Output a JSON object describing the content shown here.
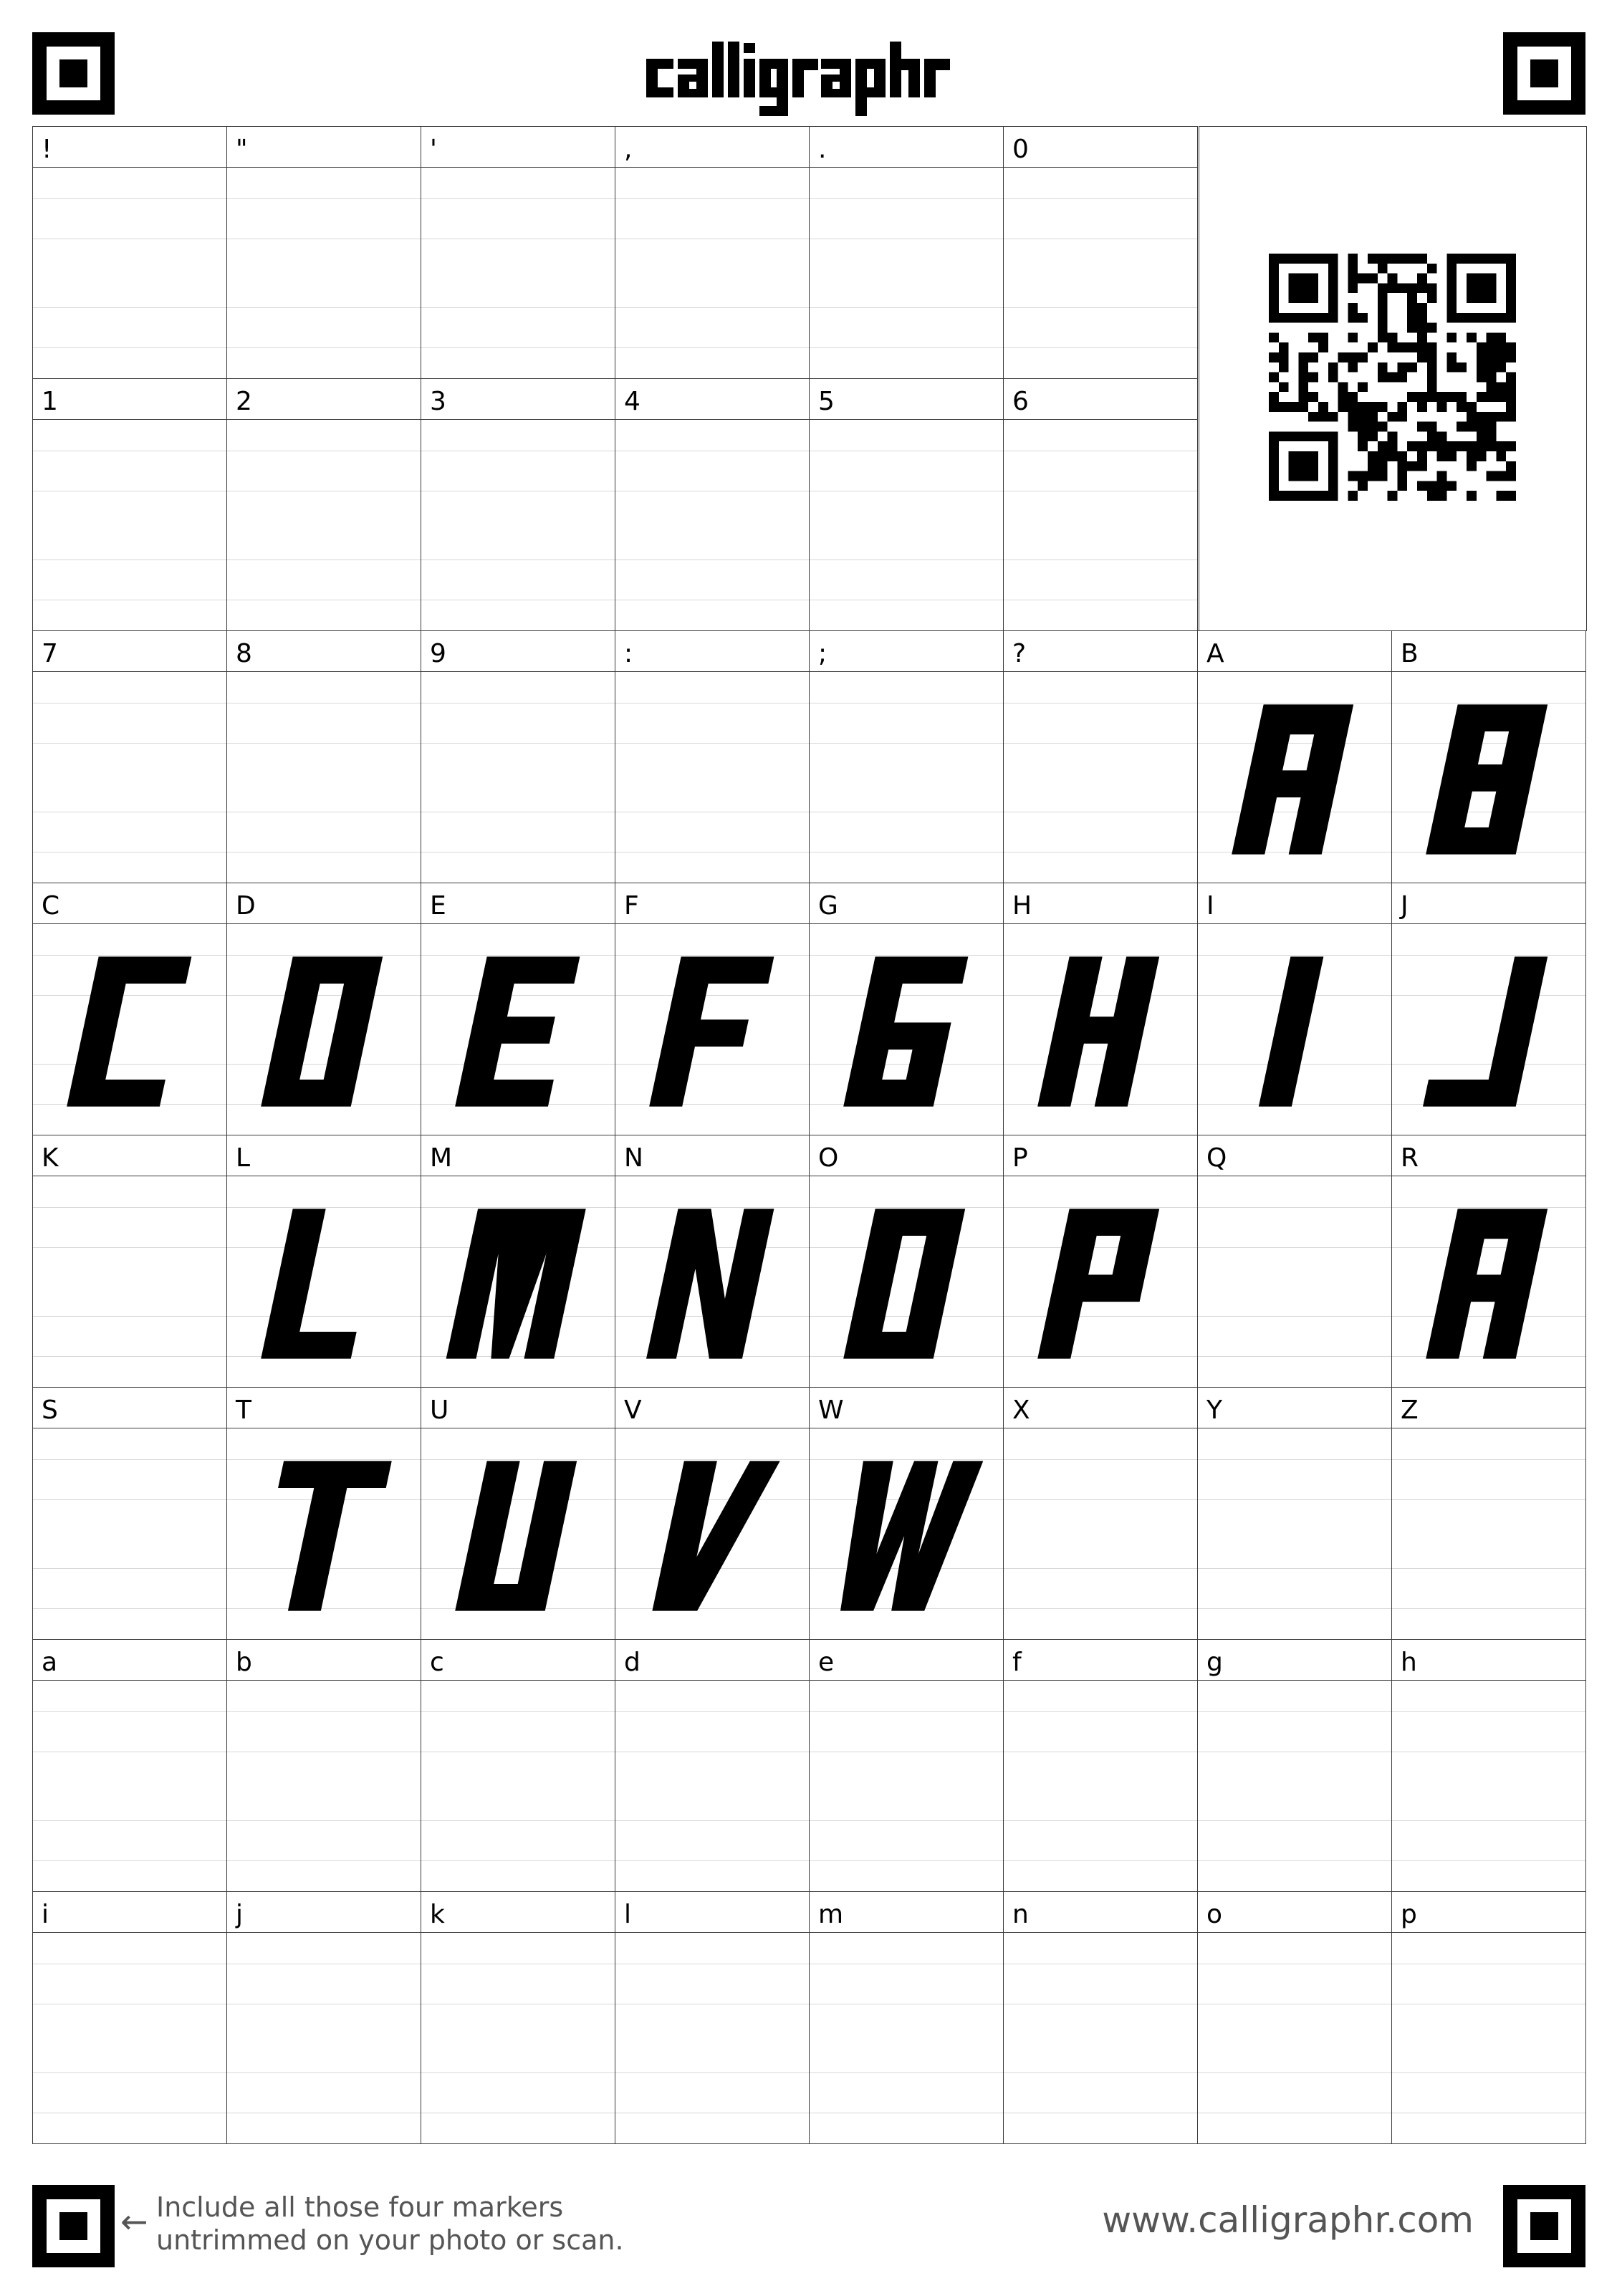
{
  "header": {
    "logo_text": "calligraphr"
  },
  "template": {
    "rows": [
      {
        "cells": [
          "!",
          "\"",
          "'",
          ",",
          ".",
          "0"
        ]
      },
      {
        "cells": [
          "1",
          "2",
          "3",
          "4",
          "5",
          "6"
        ]
      },
      {
        "cells": [
          "7",
          "8",
          "9",
          ":",
          ";",
          "?",
          "A",
          "B"
        ]
      },
      {
        "cells": [
          "C",
          "D",
          "E",
          "F",
          "G",
          "H",
          "I",
          "J"
        ]
      },
      {
        "cells": [
          "K",
          "L",
          "M",
          "N",
          "O",
          "P",
          "Q",
          "R"
        ]
      },
      {
        "cells": [
          "S",
          "T",
          "U",
          "V",
          "W",
          "X",
          "Y",
          "Z"
        ]
      },
      {
        "cells": [
          "a",
          "b",
          "c",
          "d",
          "e",
          "f",
          "g",
          "h"
        ]
      },
      {
        "cells": [
          "i",
          "j",
          "k",
          "l",
          "m",
          "n",
          "o",
          "p"
        ]
      }
    ],
    "drawn_glyphs": [
      "A",
      "B",
      "C",
      "D",
      "E",
      "F",
      "G",
      "H",
      "I",
      "J",
      "L",
      "M",
      "N",
      "O",
      "P",
      "R",
      "T",
      "U",
      "V",
      "W"
    ],
    "glyph_style": "blocky-italic-black"
  },
  "qr": {
    "icon": "qr-code-icon"
  },
  "footer": {
    "note_line1": "Include all those four markers",
    "note_line2": "untrimmed on your photo or scan.",
    "arrow": "←",
    "url": "www.calligraphr.com"
  },
  "colors": {
    "ink": "#000000",
    "grid_line": "#3a3a3a",
    "guide_line": "#d8d8d8",
    "footer_text": "#555555"
  }
}
